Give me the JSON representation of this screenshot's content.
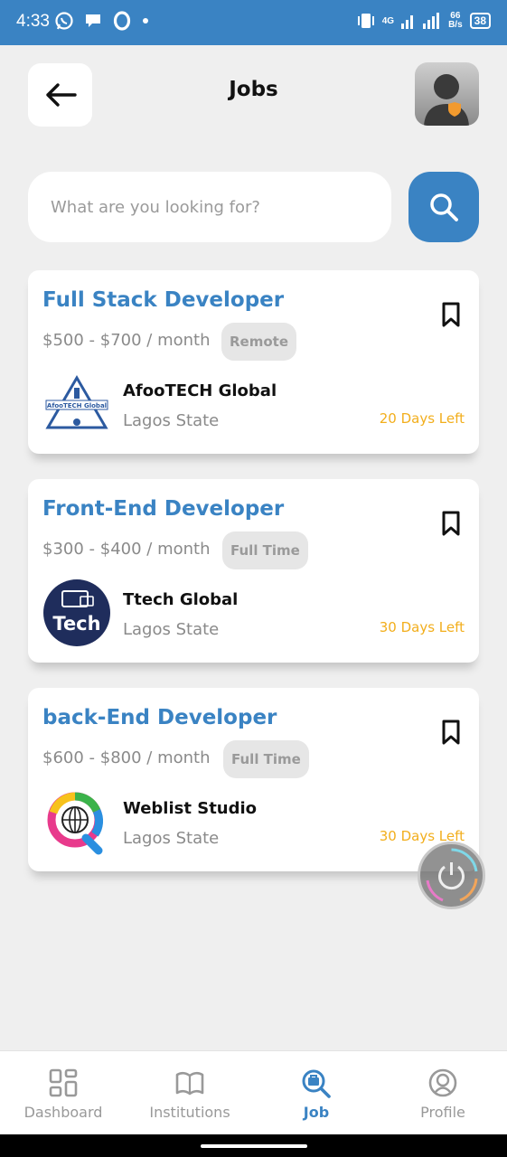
{
  "status_bar": {
    "time": "4:33",
    "network": "4G",
    "speed_top": "66",
    "speed_bottom": "B/s",
    "battery": "38"
  },
  "header": {
    "title": "Jobs"
  },
  "search": {
    "placeholder": "What are you looking for?"
  },
  "jobs": [
    {
      "title": "Full Stack Developer",
      "salary": "$500 - $700 / month",
      "tag": "Remote",
      "company": "AfooTECH Global",
      "location": "Lagos State",
      "deadline": "20 Days Left",
      "logo_text": "AfooTECH Global"
    },
    {
      "title": "Front-End Developer",
      "salary": "$300 - $400 / month",
      "tag": "Full Time",
      "company": "Ttech Global",
      "location": "Lagos State",
      "deadline": "30 Days Left",
      "logo_text": "Tech"
    },
    {
      "title": "back-End Developer",
      "salary": "$600 - $800 / month",
      "tag": "Full Time",
      "company": "Weblist Studio",
      "location": "Lagos State",
      "deadline": "30 Days Left"
    }
  ],
  "nav": [
    {
      "label": "Dashboard",
      "icon": "grid-icon"
    },
    {
      "label": "Institutions",
      "icon": "book-icon"
    },
    {
      "label": "Job",
      "icon": "job-search-icon",
      "active": true
    },
    {
      "label": "Profile",
      "icon": "user-circle-icon"
    }
  ],
  "colors": {
    "primary": "#3a83c3",
    "accent": "#f2ae1c",
    "background": "#efefef"
  }
}
